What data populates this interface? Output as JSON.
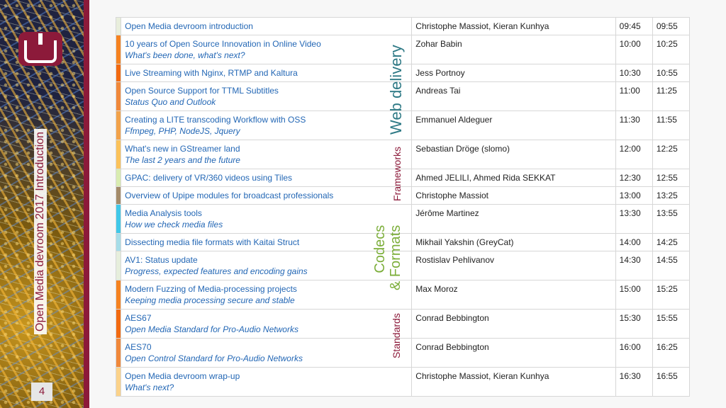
{
  "sidebar": {
    "title": "Open Media devroom 2017 Introduction",
    "page_number": "4",
    "logo_icon": "devroom-logo-icon",
    "brand_color": "#8c1a3a"
  },
  "tracks": {
    "web_delivery": "Web delivery",
    "frameworks": "Frameworks",
    "codecs_line1": "Codecs",
    "codecs_line2": "& Formats",
    "standards": "Standards"
  },
  "schedule": [
    {
      "title": "Open Media devroom introduction",
      "subtitle": "",
      "speaker": "Christophe Massiot, Kieran Kunhya",
      "start": "09:45",
      "end": "09:55",
      "color": "#e8eedc"
    },
    {
      "title": "10 years of Open Source Innovation in Online Video",
      "subtitle": "What's been done, what's next?",
      "speaker": "Zohar Babin",
      "start": "10:00",
      "end": "10:25",
      "color": "#f58220"
    },
    {
      "title": "Live Streaming with Nginx, RTMP and Kaltura",
      "subtitle": "",
      "speaker": "Jess Portnoy",
      "start": "10:30",
      "end": "10:55",
      "color": "#f26a10"
    },
    {
      "title": "Open Source Support for TTML Subtitles",
      "subtitle": "Status Quo and Outlook",
      "speaker": "Andreas Tai",
      "start": "11:00",
      "end": "11:25",
      "color": "#f0883a"
    },
    {
      "title": "Creating a LITE transcoding Workflow with OSS",
      "subtitle": "Ffmpeg, PHP, NodeJS, Jquery",
      "speaker": "Emmanuel Aldeguer",
      "start": "11:30",
      "end": "11:55",
      "color": "#f2a24a"
    },
    {
      "title": "What's new in GStreamer land",
      "subtitle": "The last 2 years and the future",
      "speaker": "Sebastian Dröge (slomo)",
      "start": "12:00",
      "end": "12:25",
      "color": "#fbc25a"
    },
    {
      "title": "GPAC: delivery of VR/360 videos using Tiles",
      "subtitle": "",
      "speaker": "Ahmed JELILI, Ahmed Rida SEKKAT",
      "start": "12:30",
      "end": "12:55",
      "color": "#d9ecb0"
    },
    {
      "title": "Overview of Upipe modules for broadcast professionals",
      "subtitle": "",
      "speaker": "Christophe Massiot",
      "start": "13:00",
      "end": "13:25",
      "color": "#a48b6a"
    },
    {
      "title": "Media Analysis tools",
      "subtitle": "How we check media files",
      "speaker": "Jérôme Martinez",
      "start": "13:30",
      "end": "13:55",
      "color": "#40c8e8"
    },
    {
      "title": "Dissecting media file formats with Kaitai Struct",
      "subtitle": "",
      "speaker": "Mikhail Yakshin (GreyCat)",
      "start": "14:00",
      "end": "14:25",
      "color": "#a6dde8"
    },
    {
      "title": "AV1: Status update",
      "subtitle": "Progress, expected features and encoding gains",
      "speaker": "Rostislav Pehlivanov",
      "start": "14:30",
      "end": "14:55",
      "color": "#e6eedc"
    },
    {
      "title": "Modern Fuzzing of Media-processing projects",
      "subtitle": "Keeping media processing secure and stable",
      "speaker": "Max Moroz",
      "start": "15:00",
      "end": "15:25",
      "color": "#f58220"
    },
    {
      "title": "AES67",
      "subtitle": "Open Media Standard for Pro-Audio Networks",
      "speaker": "Conrad Bebbington",
      "start": "15:30",
      "end": "15:55",
      "color": "#f26a10"
    },
    {
      "title": "AES70",
      "subtitle": "Open Control Standard for Pro-Audio Networks",
      "speaker": "Conrad Bebbington",
      "start": "16:00",
      "end": "16:25",
      "color": "#f0883a"
    },
    {
      "title": "Open Media devroom wrap-up",
      "subtitle": "What's next?",
      "speaker": "Christophe Massiot, Kieran Kunhya",
      "start": "16:30",
      "end": "16:55",
      "color": "#fbd28a"
    }
  ]
}
